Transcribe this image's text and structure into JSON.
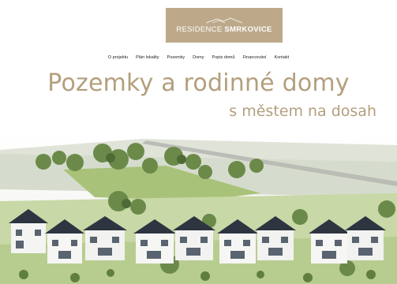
{
  "brand": {
    "logo_text_light": "RESIDENCE",
    "logo_text_bold": "SMRKOVICE",
    "logo_bg": "#bda98a"
  },
  "nav": {
    "items": [
      {
        "label": "O projektu"
      },
      {
        "label": "Plán lokality"
      },
      {
        "label": "Pozemky"
      },
      {
        "label": "Domy"
      },
      {
        "label": "Popis domů"
      },
      {
        "label": "Financování"
      },
      {
        "label": "Kontakt"
      }
    ]
  },
  "hero": {
    "title": "Pozemky a rodinné domy",
    "subtitle": "s městem na dosah",
    "accent": "#b39f7d"
  }
}
